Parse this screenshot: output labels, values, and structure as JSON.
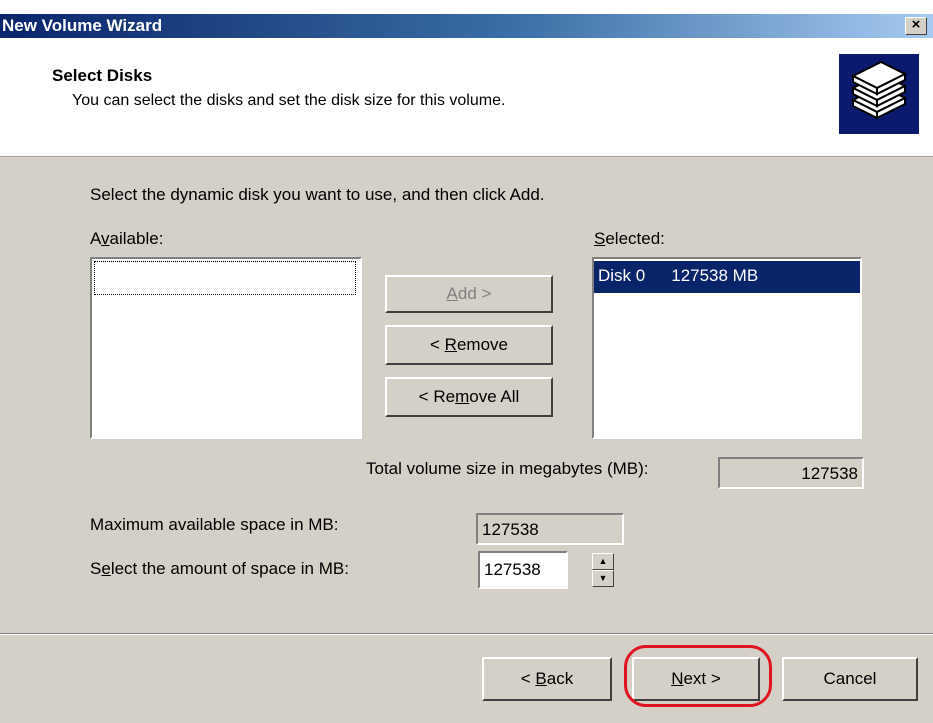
{
  "window": {
    "title": "New Volume Wizard",
    "close_label": "×"
  },
  "header": {
    "title": "Select Disks",
    "subtitle": "You can select the disks and set the disk size for this volume.",
    "icon": "disk-stack-icon"
  },
  "instruction": "Select the dynamic disk you want to use, and then click Add.",
  "available": {
    "label_pre": "A",
    "label_key": "v",
    "label_post": "ailable:",
    "items": []
  },
  "selected": {
    "label_key": "S",
    "label_post": "elected:",
    "items": [
      {
        "disk": "Disk 0",
        "size": "127538 MB"
      }
    ]
  },
  "buttons": {
    "add_key": "A",
    "add_post": "dd >",
    "remove_pre": "< ",
    "remove_key": "R",
    "remove_post": "emove",
    "remove_all_pre": "< Re",
    "remove_all_key": "m",
    "remove_all_post": "ove All",
    "back_pre": "< ",
    "back_key": "B",
    "back_post": "ack",
    "next_key": "N",
    "next_post": "ext >",
    "cancel": "Cancel"
  },
  "total": {
    "label": "Total volume size in megabytes (MB):",
    "value": "127538"
  },
  "max": {
    "label": "Maximum available space in MB:",
    "value": "127538"
  },
  "amount": {
    "label_pre": "S",
    "label_key": "e",
    "label_post": "lect the amount of space in MB:",
    "value": "127538"
  },
  "colors": {
    "title_bar": "#0a246a",
    "selection": "#0a246a",
    "highlight_ring": "#e0141e"
  }
}
